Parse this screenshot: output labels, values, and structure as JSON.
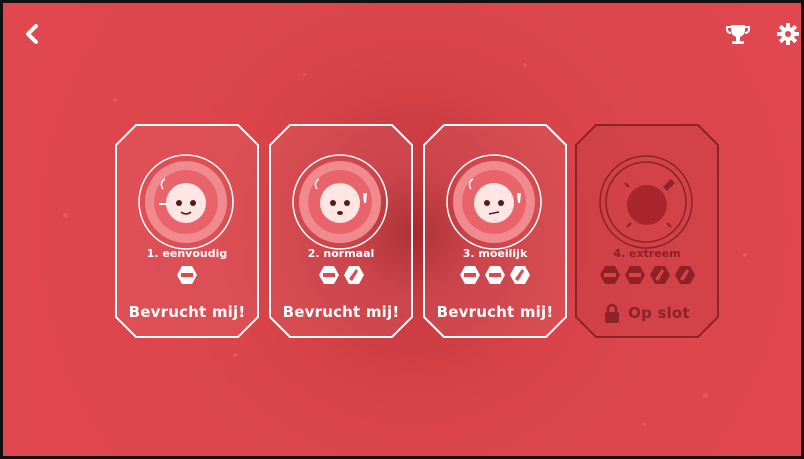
{
  "header": {
    "back_icon": "chevron-left-icon",
    "trophy_icon": "trophy-icon",
    "settings_icon": "gear-icon"
  },
  "colors": {
    "background": "#e0474f",
    "card_border": "#ffffff",
    "locked": "#8e2226"
  },
  "levels": [
    {
      "label": "1. eenvoudig",
      "action": "Bevrucht mij!",
      "icons": [
        "cigarette"
      ],
      "locked": false
    },
    {
      "label": "2. normaal",
      "action": "Bevrucht mij!",
      "icons": [
        "cigarette",
        "bottle"
      ],
      "locked": false
    },
    {
      "label": "3. moeilijk",
      "action": "Bevrucht mij!",
      "icons": [
        "cigarette",
        "cigarette",
        "bottle"
      ],
      "locked": false
    },
    {
      "label": "4. extreem",
      "action": "Op slot",
      "icons": [
        "cigarette",
        "cigarette",
        "bottle",
        "bottle"
      ],
      "locked": true
    }
  ]
}
